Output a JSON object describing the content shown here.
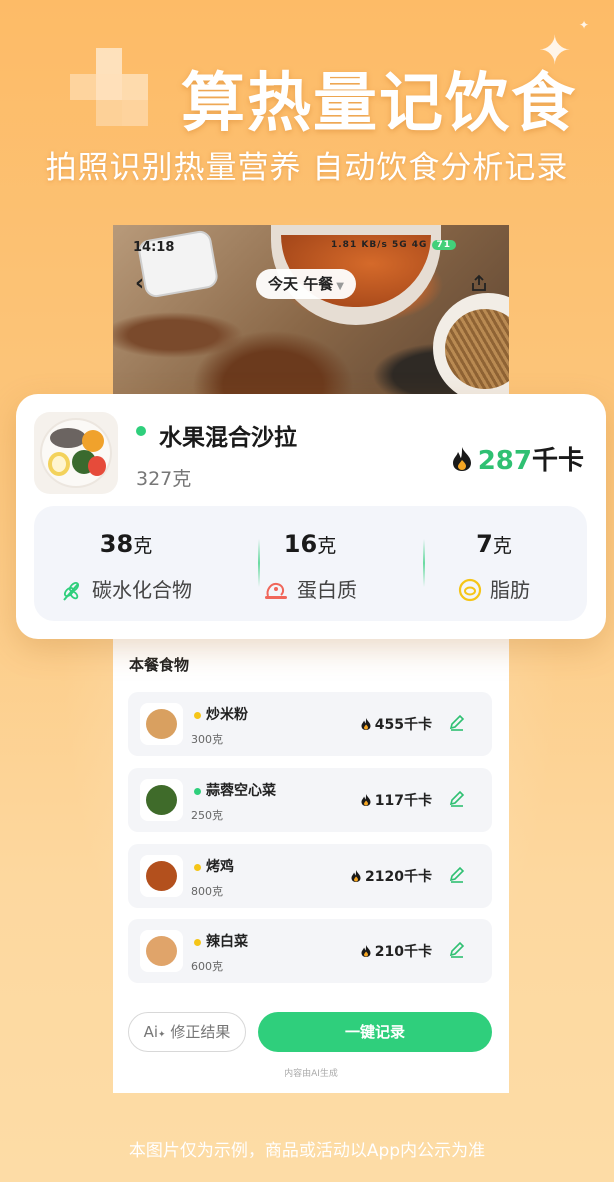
{
  "promo": {
    "headline": "算热量记饮食",
    "subheadline": "拍照识别热量营养 自动饮食分析记录",
    "footer_note": "本图片仅为示例，商品或活动以App内公示为准"
  },
  "phone": {
    "status_time": "14:18",
    "status_speed": "1.81 KB/s",
    "status_network": "5G 4G",
    "battery": "71",
    "meal_selector": "今天 午餐",
    "food_list_title": "本餐食物",
    "foods": [
      {
        "name": "炒米粉",
        "weight": "300克",
        "calories": "455千卡",
        "dot_color": "#f5c518",
        "thumb_color": "#d9a060"
      },
      {
        "name": "蒜蓉空心菜",
        "weight": "250克",
        "calories": "117千卡",
        "dot_color": "#2fcf7c",
        "thumb_color": "#3f6b2a"
      },
      {
        "name": "烤鸡",
        "weight": "800克",
        "calories": "2120千卡",
        "dot_color": "#f5c518",
        "thumb_color": "#b3501d"
      },
      {
        "name": "辣白菜",
        "weight": "600克",
        "calories": "210千卡",
        "dot_color": "#f5c518",
        "thumb_color": "#e0a46a"
      }
    ],
    "fix_button": "修正结果",
    "fix_button_prefix": "Ai",
    "record_button": "一键记录",
    "ai_note": "内容由AI生成"
  },
  "card": {
    "dish_name": "水果混合沙拉",
    "dish_weight": "327克",
    "calories_value": "287",
    "calories_unit": "千卡",
    "macros": [
      {
        "value": "38",
        "unit": "克",
        "label": "碳水化合物",
        "icon": "wheat-icon",
        "color": "#2fcf7c"
      },
      {
        "value": "16",
        "unit": "克",
        "label": "蛋白质",
        "icon": "meat-icon",
        "color": "#f0665a"
      },
      {
        "value": "7",
        "unit": "克",
        "label": "脂肪",
        "icon": "fat-icon",
        "color": "#f5c518"
      }
    ]
  },
  "colors": {
    "accent_green": "#2fcf7c",
    "calorie_green": "#2fc072",
    "background_orange": "#fdbb67"
  }
}
